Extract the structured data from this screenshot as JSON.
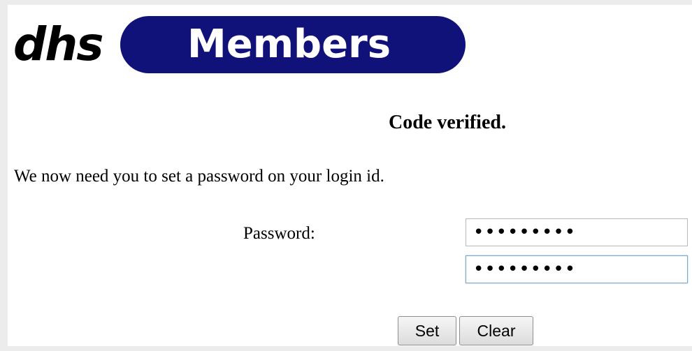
{
  "header": {
    "logo_text": "dhs",
    "banner_text": "Members",
    "banner_color": "#10127a"
  },
  "main": {
    "heading": "Code verified.",
    "instruction": "We now need you to set a password on your login id.",
    "password_label": "Password:",
    "password_value": "•••••••••",
    "confirm_password_value": "•••••••••"
  },
  "actions": {
    "set_label": "Set",
    "clear_label": "Clear"
  }
}
